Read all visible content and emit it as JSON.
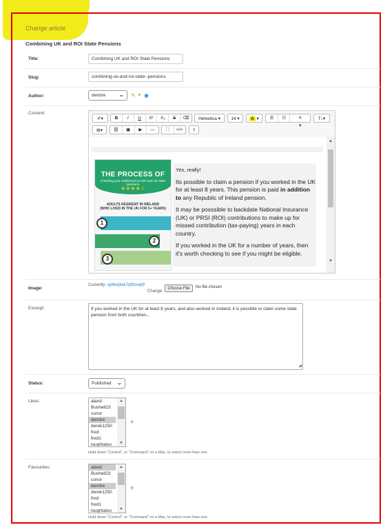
{
  "header": {
    "change_title": "Change article",
    "article_title": "Combining UK and ROI State Pensions"
  },
  "fields": {
    "title_label": "Title:",
    "title_value": "Combining UK and ROI State Pensions",
    "slug_label": "Slug:",
    "slug_value": "combining-uk-and-roi-state--pensions",
    "author_label": "Author:",
    "author_value": "deirdre",
    "content_label": "Content:",
    "image_label": "Image:",
    "image_currently": "Currently:",
    "image_filename": "ojdikwjtwk7qt9oxejl9",
    "image_change": "Change:",
    "choose_file_label": "Choose File",
    "no_file_label": "No file chosen",
    "excerpt_label": "Excerpt:",
    "excerpt_value": "If you worked in the UK for at least 8 years, and also worked in Ireland, it is possible to claim some state pension from both countries...",
    "status_label": "Status:",
    "status_value": "Published",
    "likes_label": "Likes:",
    "favourites_label": "Favourites:",
    "help_text": "Hold down \"Control\", or \"Command\" on a Mac, to select more than one."
  },
  "likes_options": [
    {
      "label": "aland",
      "selected": false
    },
    {
      "label": "Bushell23",
      "selected": false
    },
    {
      "label": "conor",
      "selected": false
    },
    {
      "label": "deirdre",
      "selected": true
    },
    {
      "label": "derek1250",
      "selected": false
    },
    {
      "label": "fred",
      "selected": false
    },
    {
      "label": "fred1",
      "selected": false
    },
    {
      "label": "loughtaloo",
      "selected": false
    }
  ],
  "favourites_options": [
    {
      "label": "aland",
      "selected": true
    },
    {
      "label": "Bushell23",
      "selected": false
    },
    {
      "label": "conor",
      "selected": false
    },
    {
      "label": "deirdre",
      "selected": true
    },
    {
      "label": "derek1250",
      "selected": false
    },
    {
      "label": "fred",
      "selected": false
    },
    {
      "label": "fred1",
      "selected": false
    },
    {
      "label": "loughtaloo",
      "selected": false
    }
  ],
  "toolbar": {
    "font_name": "Helvetica",
    "font_size": "14",
    "font_color": "A",
    "bold": "B",
    "italic": "I",
    "underline": "U",
    "superscript": "X²",
    "subscript": "X₂",
    "strike": "S",
    "eraser": "⌫",
    "ul": "☰",
    "ol": "☷",
    "align": "≡",
    "lineheight": "T↕",
    "table": "⊞",
    "link": "⛓",
    "picture": "▣",
    "video": "▶",
    "hr": "—",
    "fullscreen": "⛶",
    "code": "</>",
    "help": "?"
  },
  "content": {
    "p1": "Yes, really!",
    "p2_pre": "Its possible to claim a pension if you worked in the UK for at least 8 years. This pension is paid ",
    "p2_bold": "in addition to",
    "p2_post": " any Republic of Ireland pension.",
    "p3": "It may be posssible to backdate National Insurance (UK) or PRSI (ROI) contributions to make up for missed contribution (tax-paying) years in each country.",
    "p4": "If you worked in the UK for a number of years, then it's worth checking to see if you might be eligible."
  },
  "infographic": {
    "title": "THE PROCESS OF",
    "subtitle": "Checking your entitlement to Irish and UK state pensions",
    "stars": "★★★★☆",
    "mid_line1": "ADULTS RESIDENT IN IRELAND",
    "mid_line2": "(WHO LIVED IN THE UK FOR 5+ YEARS)",
    "step1": "1",
    "step2": "2",
    "step3": "3"
  },
  "colors": {
    "frame_red": "#e00000",
    "highlight": "#f3ec1a",
    "ig_green": "#23a36b",
    "ig_teal": "#3bb6c4",
    "ig_lightgreen": "#a8d08d"
  }
}
